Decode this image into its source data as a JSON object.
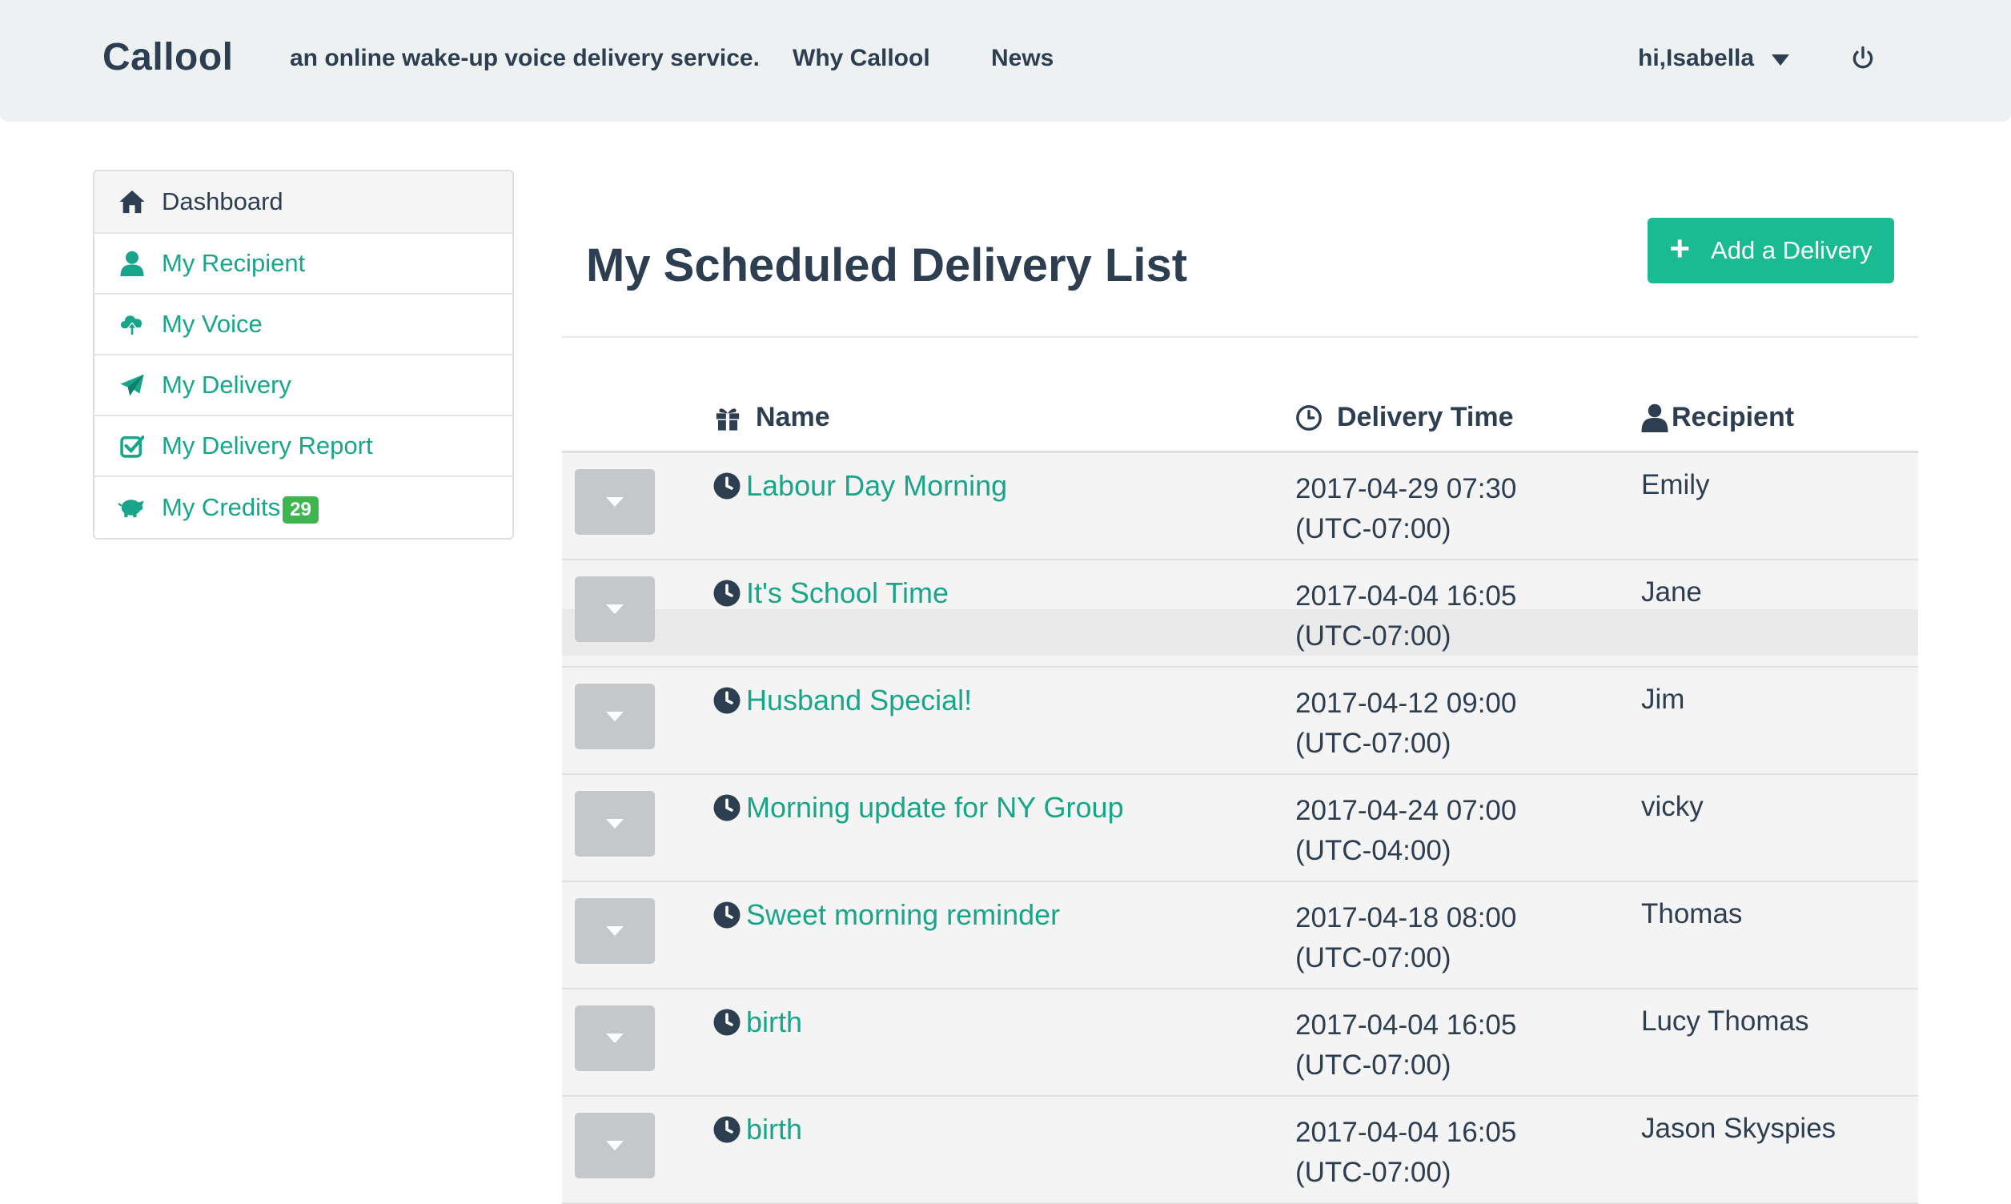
{
  "navbar": {
    "brand": "Callool",
    "tagline": "an online wake-up voice delivery service.",
    "links": [
      "Why Callool",
      "News"
    ],
    "user_greeting": "hi,Isabella",
    "icons": {
      "user_caret": "caret-down-icon",
      "logout": "power-icon"
    }
  },
  "sidebar": {
    "items": [
      {
        "label": "Dashboard",
        "icon": "home-icon",
        "active": true
      },
      {
        "label": "My Recipient",
        "icon": "user-icon"
      },
      {
        "label": "My Voice",
        "icon": "cloud-upload-icon"
      },
      {
        "label": "My Delivery",
        "icon": "paper-plane-icon"
      },
      {
        "label": "My Delivery Report",
        "icon": "check-square-icon"
      },
      {
        "label": "My Credits",
        "icon": "piggy-bank-icon",
        "badge": "29"
      }
    ]
  },
  "main": {
    "title": "My Scheduled Delivery List",
    "add_button": "Add a Delivery",
    "table": {
      "headers": {
        "name": "Name",
        "time": "Delivery Time",
        "recipient": "Recipient"
      },
      "rows": [
        {
          "name": "Labour Day Morning",
          "time": "2017-04-29 07:30",
          "tz": "(UTC-07:00)",
          "recipient": "Emily"
        },
        {
          "name": "It's School Time",
          "time": "2017-04-04 16:05",
          "tz": "(UTC-07:00)",
          "recipient": "Jane"
        },
        {
          "name": "Husband Special!",
          "time": "2017-04-12 09:00",
          "tz": "(UTC-07:00)",
          "recipient": "Jim"
        },
        {
          "name": "Morning update for NY Group",
          "time": "2017-04-24 07:00",
          "tz": "(UTC-04:00)",
          "recipient": "vicky"
        },
        {
          "name": "Sweet morning reminder",
          "time": "2017-04-18 08:00",
          "tz": "(UTC-07:00)",
          "recipient": "Thomas"
        },
        {
          "name": "birth",
          "time": "2017-04-04 16:05",
          "tz": "(UTC-07:00)",
          "recipient": "Lucy Thomas"
        },
        {
          "name": "birth",
          "time": "2017-04-04 16:05",
          "tz": "(UTC-07:00)",
          "recipient": "Jason Skyspies"
        }
      ]
    }
  },
  "colors": {
    "accent": "#18a589",
    "button": "#1aba93",
    "badge": "#3fb54f",
    "text": "#2c3e50",
    "navbar_bg": "#eef1f2"
  }
}
